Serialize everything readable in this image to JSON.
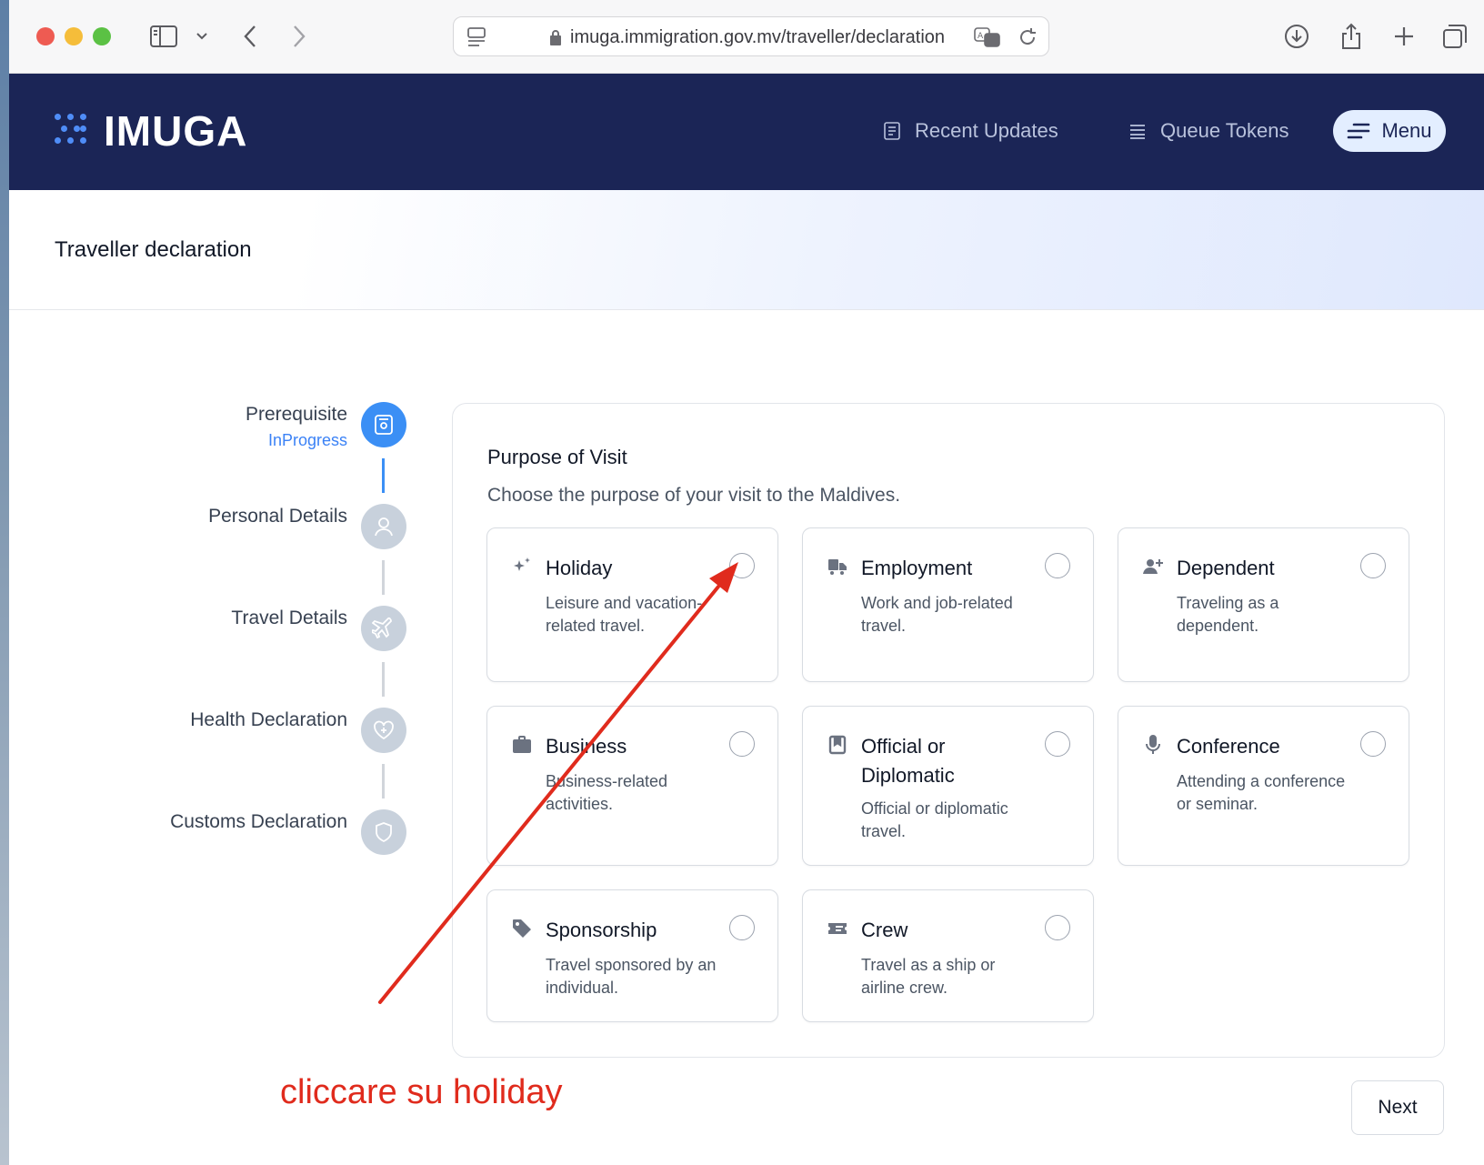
{
  "browser": {
    "url": "imuga.immigration.gov.mv/traveller/declaration"
  },
  "header": {
    "logo": "IMUGA",
    "nav": {
      "recent_updates": "Recent Updates",
      "queue_tokens": "Queue Tokens",
      "menu": "Menu"
    }
  },
  "page": {
    "title": "Traveller declaration"
  },
  "stepper": {
    "steps": [
      {
        "label": "Prerequisite",
        "status": "InProgress",
        "icon": "passport-icon"
      },
      {
        "label": "Personal Details",
        "icon": "user-icon"
      },
      {
        "label": "Travel Details",
        "icon": "plane-icon"
      },
      {
        "label": "Health Declaration",
        "icon": "heart-icon"
      },
      {
        "label": "Customs Declaration",
        "icon": "shield-icon"
      }
    ]
  },
  "form": {
    "title": "Purpose of Visit",
    "subtitle": "Choose the purpose of your visit to the Maldives.",
    "options": [
      {
        "title": "Holiday",
        "desc": "Leisure and vacation-related travel.",
        "icon": "sparkles-icon"
      },
      {
        "title": "Employment",
        "desc": "Work and job-related travel.",
        "icon": "truck-icon"
      },
      {
        "title": "Dependent",
        "desc": "Traveling as a dependent.",
        "icon": "user-plus-icon"
      },
      {
        "title": "Business",
        "desc": "Business-related activities.",
        "icon": "briefcase-icon"
      },
      {
        "title": "Official or Diplomatic",
        "desc": "Official or diplomatic travel.",
        "icon": "bookmark-icon"
      },
      {
        "title": "Conference",
        "desc": "Attending a conference or seminar.",
        "icon": "microphone-icon"
      },
      {
        "title": "Sponsorship",
        "desc": "Travel sponsored by an individual.",
        "icon": "tag-icon"
      },
      {
        "title": "Crew",
        "desc": "Travel as a ship or airline crew.",
        "icon": "ticket-icon"
      }
    ],
    "next": "Next"
  },
  "annotation": {
    "text": "cliccare su holiday",
    "color": "#e02b1d"
  },
  "colors": {
    "header_bg": "#1b2556",
    "accent": "#3b8ff5"
  }
}
